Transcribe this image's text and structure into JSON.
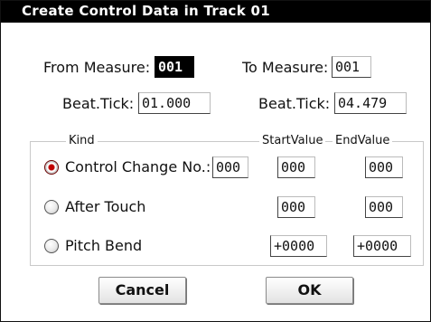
{
  "window": {
    "title": "Create Control Data in Track 01"
  },
  "range": {
    "from_measure_label": "From Measure:",
    "from_measure_value": "001",
    "to_measure_label": "To Measure:",
    "to_measure_value": "001",
    "from_beat_label": "Beat.Tick:",
    "from_beat_value": "01.000",
    "to_beat_label": "Beat.Tick:",
    "to_beat_value": "04.479"
  },
  "kind": {
    "legend": "Kind",
    "start_header": "StartValue",
    "end_header": "EndValue",
    "options": [
      {
        "label": "Control Change No.:",
        "selected": true,
        "cc_number": "000",
        "start": "000",
        "end": "000"
      },
      {
        "label": "After Touch",
        "selected": false,
        "start": "000",
        "end": "000"
      },
      {
        "label": "Pitch Bend",
        "selected": false,
        "start": "+0000",
        "end": "+0000"
      }
    ]
  },
  "buttons": {
    "cancel_label": "Cancel",
    "ok_label": "OK"
  }
}
